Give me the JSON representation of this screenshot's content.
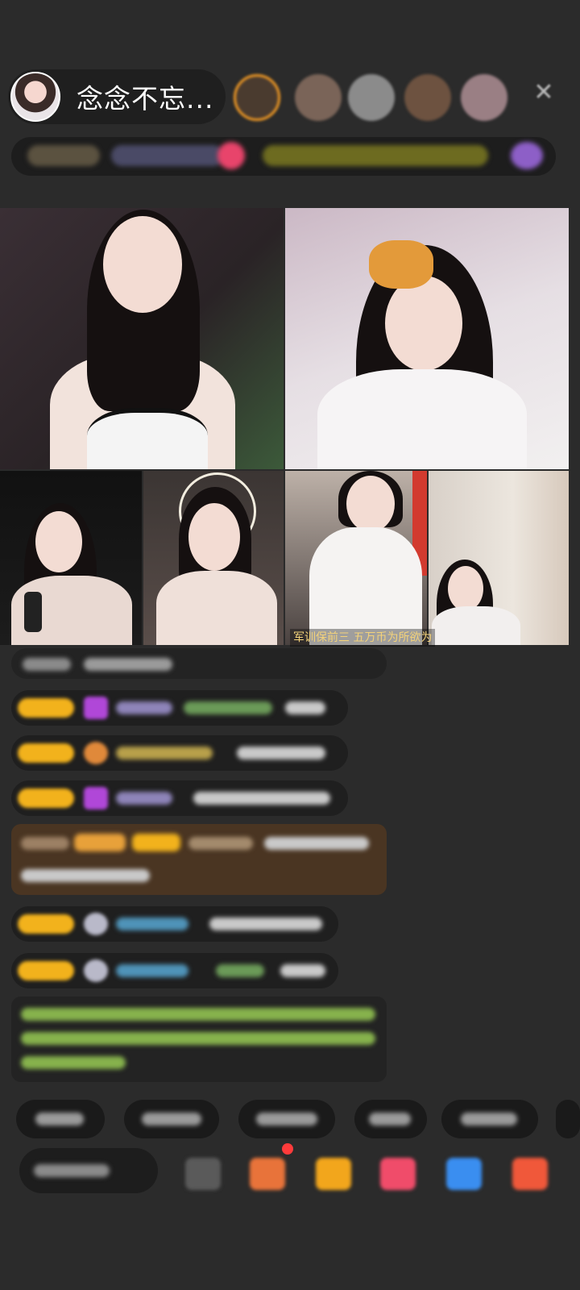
{
  "header": {
    "host_name": "念念不忘..."
  },
  "video": {
    "caption": "军训保前三   五万币为所欲为"
  },
  "colors": {
    "background": "#2b2b2b",
    "accent_yellow": "#f2b21c",
    "viewer_ring": "#f29a24"
  },
  "icons": {
    "close": "close-icon"
  }
}
